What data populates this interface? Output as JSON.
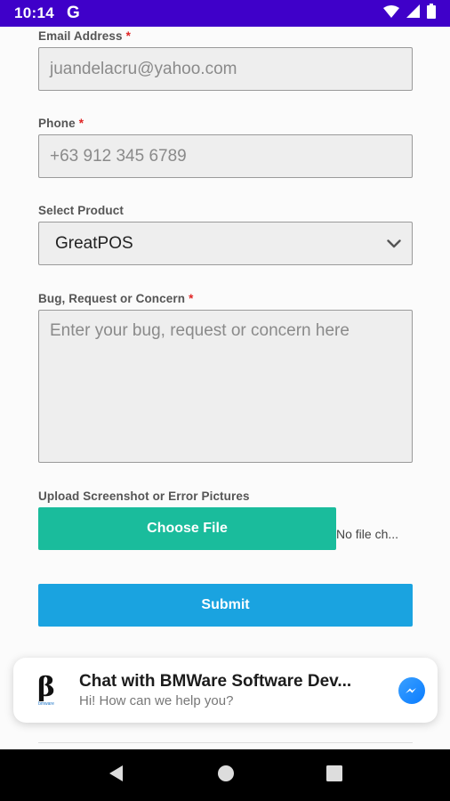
{
  "status_bar": {
    "time": "10:14",
    "g_letter": "G",
    "icons": [
      "wifi-icon",
      "signal-icon",
      "battery-icon"
    ]
  },
  "form": {
    "email": {
      "label": "Email Address",
      "required_mark": "*",
      "placeholder": "juandelacru@yahoo.com"
    },
    "phone": {
      "label": "Phone",
      "required_mark": "*",
      "placeholder": "+63 912 345 6789"
    },
    "product": {
      "label": "Select Product",
      "selected": "GreatPOS"
    },
    "concern": {
      "label": "Bug, Request or Concern",
      "required_mark": "*",
      "placeholder": "Enter your bug, request or concern here"
    },
    "upload": {
      "label": "Upload Screenshot or Error Pictures",
      "button_label": "Choose File",
      "status": "No file ch..."
    },
    "submit_label": "Submit"
  },
  "chat_widget": {
    "logo_char": "β",
    "logo_text": "bmware",
    "title": "Chat with BMWare Software Dev...",
    "subtitle": "Hi! How can we help you?"
  },
  "colors": {
    "status_bar": "#3f00c9",
    "choose_file": "#1abc9c",
    "submit": "#1aa3e0",
    "required": "#e02424"
  },
  "nav_bar": {
    "icons": [
      "back-icon",
      "home-icon",
      "recents-icon"
    ]
  }
}
